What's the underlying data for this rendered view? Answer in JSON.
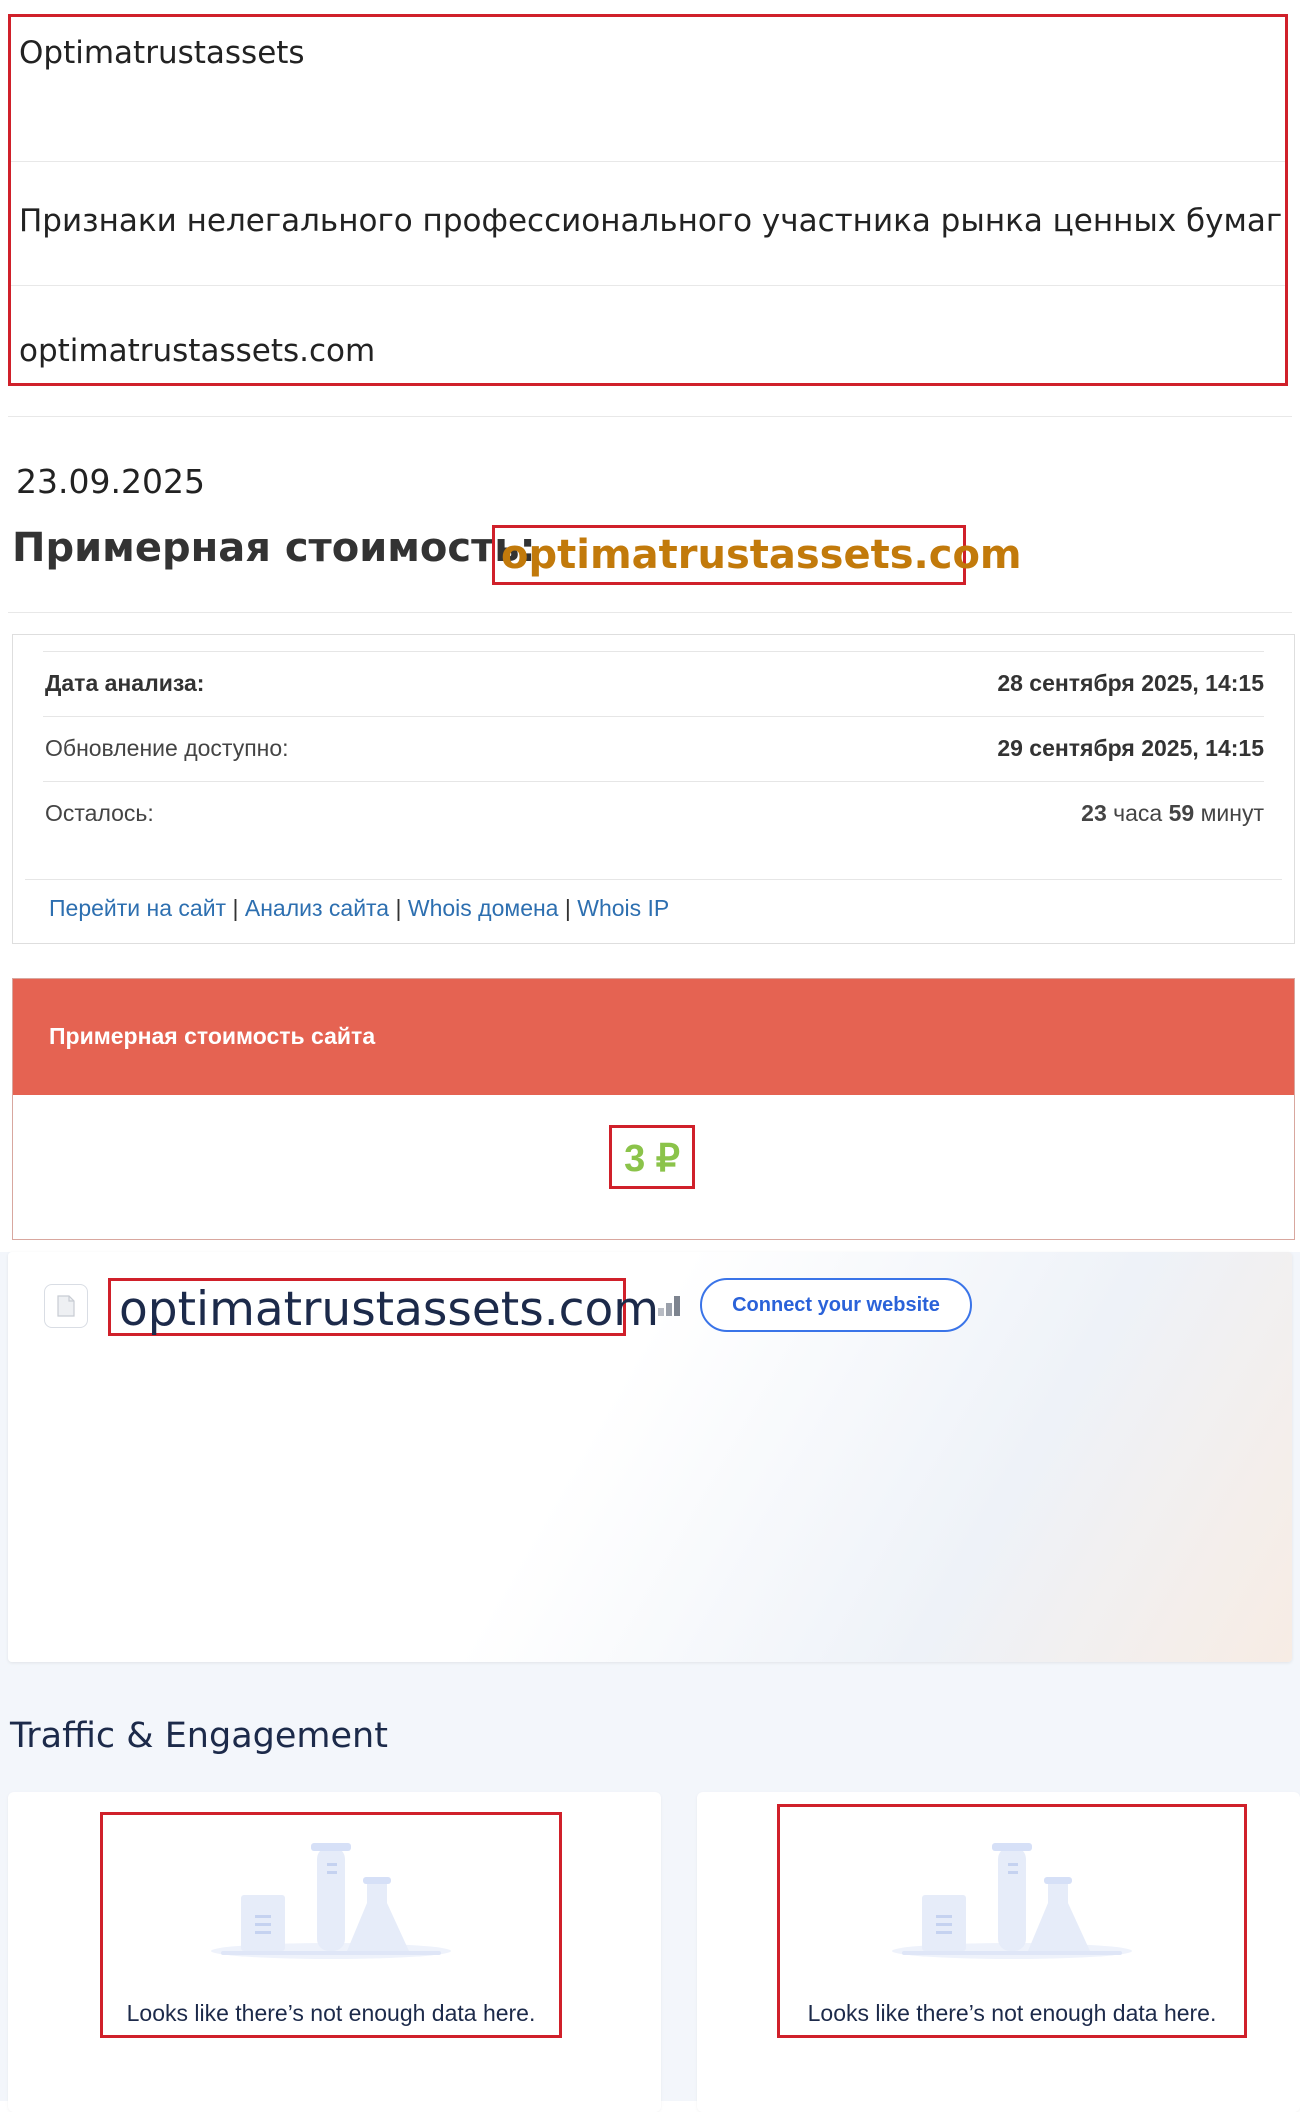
{
  "top": {
    "name": "Optimatrustassets",
    "reason": "Признаки нелегального профессионального участника рынка ценных бумаг",
    "domain": "optimatrustassets.com"
  },
  "date": "23.09.2025",
  "value_title": "Примерная стоимость:",
  "value_title_domain": "optimatrustassets.com",
  "analysis": {
    "rows": [
      {
        "label": "Дата анализа:",
        "value": "28 сентября 2025, 14:15"
      },
      {
        "label": "Обновление доступно:",
        "value": "29 сентября 2025, 14:15"
      },
      {
        "label": "Осталось:",
        "value_hours": "23",
        "value_hours_word": "часа",
        "value_minutes": "59",
        "value_minutes_word": "минут"
      }
    ],
    "links": [
      "Перейти на сайт",
      "Анализ сайта",
      "Whois домена",
      "Whois IP"
    ],
    "separator": "|"
  },
  "price": {
    "title": "Примерная стоимость сайта",
    "value": "3 ₽"
  },
  "site": {
    "domain": "optimatrustassets.com",
    "connect_label": "Connect your website"
  },
  "traffic": {
    "title": "Traffic & Engagement",
    "empty_left": "Looks like there’s not enough data here.",
    "empty_right": "Looks like there’s not enough data here."
  },
  "colors": {
    "accent_red": "#e56352",
    "highlight_box": "#d0202a",
    "domain_orange": "#c27a0b",
    "price_green": "#8bc34a",
    "link_blue": "#2d6fb0",
    "connect_blue": "#2a62d9"
  }
}
